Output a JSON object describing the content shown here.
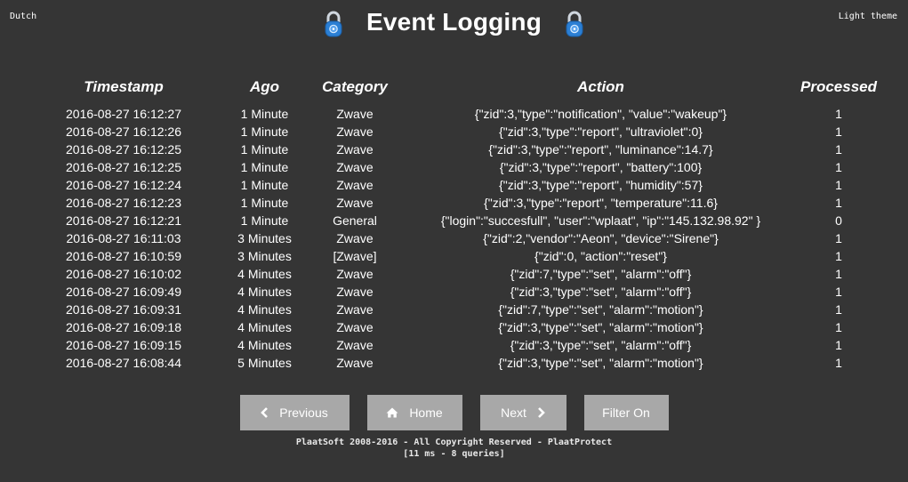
{
  "top": {
    "language_link": "Dutch",
    "theme_link": "Light theme"
  },
  "header": {
    "title": "Event Logging",
    "lock_color": "#2b7fd4"
  },
  "table": {
    "columns": [
      "Timestamp",
      "Ago",
      "Category",
      "Action",
      "Processed"
    ],
    "rows": [
      {
        "timestamp": "2016-08-27 16:12:27",
        "ago": "1 Minute",
        "category": "Zwave",
        "action": "{\"zid\":3,\"type\":\"notification\", \"value\":\"wakeup\"}",
        "processed": "1"
      },
      {
        "timestamp": "2016-08-27 16:12:26",
        "ago": "1 Minute",
        "category": "Zwave",
        "action": "{\"zid\":3,\"type\":\"report\", \"ultraviolet\":0}",
        "processed": "1"
      },
      {
        "timestamp": "2016-08-27 16:12:25",
        "ago": "1 Minute",
        "category": "Zwave",
        "action": "{\"zid\":3,\"type\":\"report\", \"luminance\":14.7}",
        "processed": "1"
      },
      {
        "timestamp": "2016-08-27 16:12:25",
        "ago": "1 Minute",
        "category": "Zwave",
        "action": "{\"zid\":3,\"type\":\"report\", \"battery\":100}",
        "processed": "1"
      },
      {
        "timestamp": "2016-08-27 16:12:24",
        "ago": "1 Minute",
        "category": "Zwave",
        "action": "{\"zid\":3,\"type\":\"report\", \"humidity\":57}",
        "processed": "1"
      },
      {
        "timestamp": "2016-08-27 16:12:23",
        "ago": "1 Minute",
        "category": "Zwave",
        "action": "{\"zid\":3,\"type\":\"report\", \"temperature\":11.6}",
        "processed": "1"
      },
      {
        "timestamp": "2016-08-27 16:12:21",
        "ago": "1 Minute",
        "category": "General",
        "action": "{\"login\":\"succesfull\", \"user\":\"wplaat\", \"ip\":\"145.132.98.92\" }",
        "processed": "0"
      },
      {
        "timestamp": "2016-08-27 16:11:03",
        "ago": "3 Minutes",
        "category": "Zwave",
        "action": "{\"zid\":2,\"vendor\":\"Aeon\", \"device\":\"Sirene\"}",
        "processed": "1"
      },
      {
        "timestamp": "2016-08-27 16:10:59",
        "ago": "3 Minutes",
        "category": "[Zwave]",
        "action": "{\"zid\":0, \"action\":\"reset\"}",
        "processed": "1"
      },
      {
        "timestamp": "2016-08-27 16:10:02",
        "ago": "4 Minutes",
        "category": "Zwave",
        "action": "{\"zid\":7,\"type\":\"set\", \"alarm\":\"off\"}",
        "processed": "1"
      },
      {
        "timestamp": "2016-08-27 16:09:49",
        "ago": "4 Minutes",
        "category": "Zwave",
        "action": "{\"zid\":3,\"type\":\"set\", \"alarm\":\"off\"}",
        "processed": "1"
      },
      {
        "timestamp": "2016-08-27 16:09:31",
        "ago": "4 Minutes",
        "category": "Zwave",
        "action": "{\"zid\":7,\"type\":\"set\", \"alarm\":\"motion\"}",
        "processed": "1"
      },
      {
        "timestamp": "2016-08-27 16:09:18",
        "ago": "4 Minutes",
        "category": "Zwave",
        "action": "{\"zid\":3,\"type\":\"set\", \"alarm\":\"motion\"}",
        "processed": "1"
      },
      {
        "timestamp": "2016-08-27 16:09:15",
        "ago": "4 Minutes",
        "category": "Zwave",
        "action": "{\"zid\":3,\"type\":\"set\", \"alarm\":\"off\"}",
        "processed": "1"
      },
      {
        "timestamp": "2016-08-27 16:08:44",
        "ago": "5 Minutes",
        "category": "Zwave",
        "action": "{\"zid\":3,\"type\":\"set\", \"alarm\":\"motion\"}",
        "processed": "1"
      }
    ]
  },
  "nav": {
    "previous": {
      "label": "Previous",
      "icon": "chevron-left-icon"
    },
    "home": {
      "label": "Home",
      "icon": "home-icon"
    },
    "next": {
      "label": "Next",
      "icon": "chevron-right-icon"
    },
    "filter": {
      "label": "Filter On"
    }
  },
  "footer": {
    "copyright": "PlaatSoft 2008-2016 - All Copyright Reserved - PlaatProtect",
    "stats": "[11 ms - 8 queries]"
  },
  "colors": {
    "background": "#353535",
    "button": "#a8a8a8",
    "text": "#ffffff"
  }
}
